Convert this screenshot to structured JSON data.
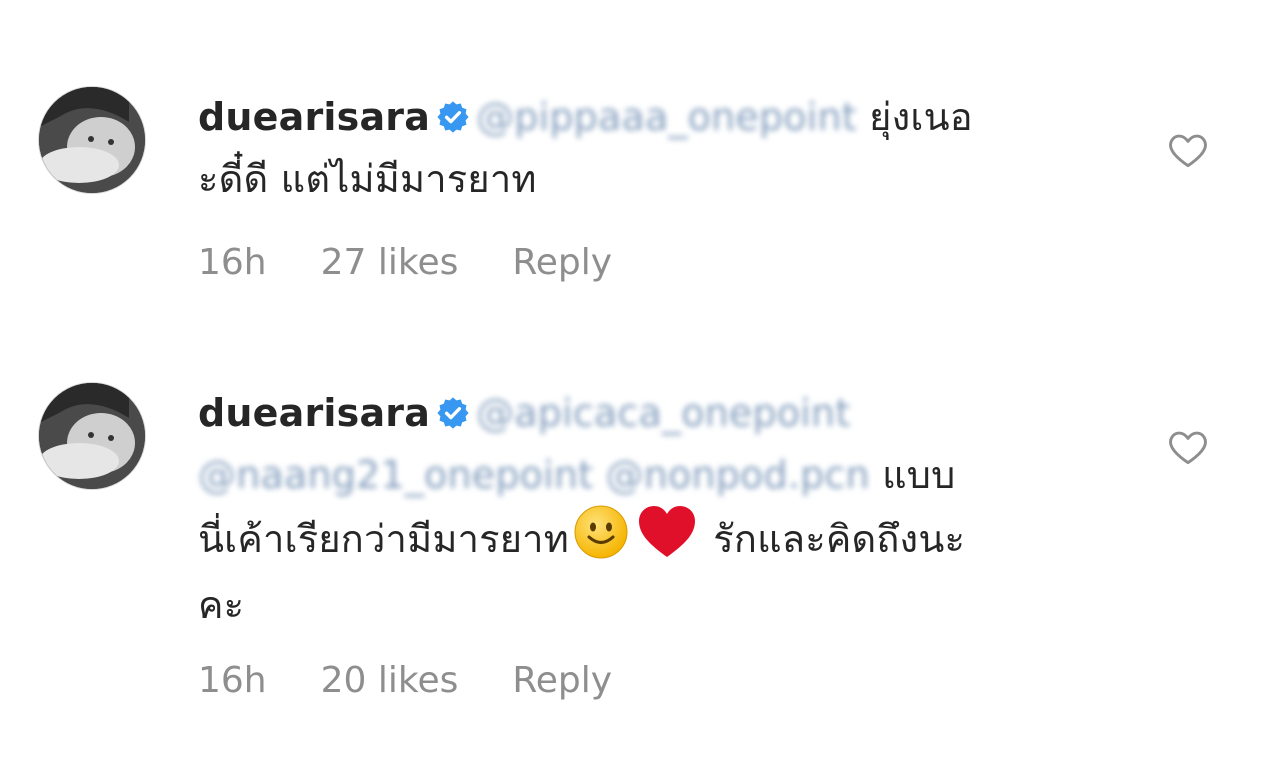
{
  "comments": [
    {
      "username": "duearisara",
      "mentions": [
        "@pippaaa_onepoint"
      ],
      "text_before_line": "ยุ่งเนอ",
      "text": "ะดี๋ดี แต่ไม่มีมารยาท",
      "time": "16h",
      "likes": "27 likes",
      "reply": "Reply",
      "icons": [
        "verified-badge-icon",
        "heart-outline-icon"
      ]
    },
    {
      "username": "duearisara",
      "mentions": [
        "@apicaca_onepoint",
        "@naang21_onepoint @nonpod.pcn"
      ],
      "text_after_mentions": "แบบ",
      "text_line3": "นี่เค้าเรียกว่ามีมารยาท",
      "text_after_emoji": "รักและคิดถึงนะ",
      "text_line4": "คะ",
      "emojis": [
        "slightly-smiling-face",
        "red-heart"
      ],
      "time": "16h",
      "likes": "20 likes",
      "reply": "Reply",
      "icons": [
        "verified-badge-icon",
        "heart-outline-icon"
      ]
    }
  ],
  "colors": {
    "text": "#262626",
    "meta": "#8e8e8e",
    "verified": "#3897f0",
    "heart": "#e0102a"
  }
}
